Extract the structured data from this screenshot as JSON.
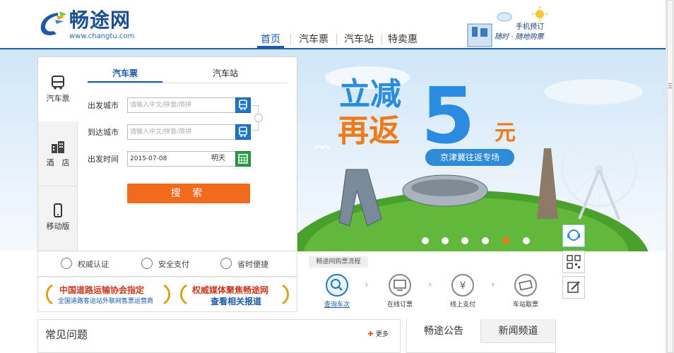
{
  "header": {
    "logo_text": "畅途网",
    "logo_url": "www.changtu.com",
    "nav": [
      {
        "label": "首页",
        "active": true
      },
      {
        "label": "汽车票",
        "active": false
      },
      {
        "label": "汽车站",
        "active": false
      },
      {
        "label": "特卖惠",
        "active": false
      }
    ],
    "mobile_promo": {
      "line1": "手机预订",
      "line2": "随时 · 随地购票"
    }
  },
  "search_panel": {
    "side_tabs": [
      {
        "label": "汽车票",
        "icon": "bus-icon",
        "active": true
      },
      {
        "label": "酒　店",
        "icon": "building-icon",
        "active": false
      },
      {
        "label": "移动版",
        "icon": "phone-icon",
        "active": false
      }
    ],
    "top_tabs": [
      {
        "label": "汽车票",
        "active": true
      },
      {
        "label": "汽车站",
        "active": false
      }
    ],
    "fields": {
      "from_label": "出发城市",
      "from_placeholder": "请输入中文/拼音/简拼",
      "to_label": "到达城市",
      "to_placeholder": "请输入中文/拼音/简拼",
      "date_label": "出发时间",
      "date_value": "2015-07-08",
      "date_hint": "明天"
    },
    "search_button": "搜 索"
  },
  "trust": [
    {
      "label": "权威认证",
      "icon": "shield-icon"
    },
    {
      "label": "安全支付",
      "icon": "secure-pay-icon"
    },
    {
      "label": "省时便捷",
      "icon": "refresh-icon"
    }
  ],
  "awards": {
    "left_title": "中国道路运输协会指定",
    "left_sub": "全国道路客运站外联网售票运营商",
    "right_title": "权威媒体聚焦畅途网",
    "right_sub": "查看相关报道"
  },
  "banner": {
    "headline1": "立减",
    "headline2": "再返",
    "amount": "5",
    "unit": "元",
    "sub": "京津冀往返专场",
    "dots": 6,
    "active_dot": 5
  },
  "process": {
    "label": "畅途网购票流程",
    "steps": [
      {
        "label": "查询车次",
        "icon": "search-icon",
        "active": true
      },
      {
        "label": "在线订票",
        "icon": "monitor-icon",
        "active": false
      },
      {
        "label": "线上支付",
        "icon": "yen-icon",
        "active": false
      },
      {
        "label": "车站取票",
        "icon": "ticket-icon",
        "active": false
      }
    ]
  },
  "floats": [
    {
      "icon": "customer-service-icon"
    },
    {
      "icon": "qr-code-icon"
    },
    {
      "icon": "edit-icon"
    }
  ],
  "faq": {
    "title": "常见问题",
    "more": "更多"
  },
  "news": {
    "tabs": [
      {
        "label": "畅途公告",
        "active": true
      },
      {
        "label": "新闻频道",
        "active": false
      }
    ]
  },
  "colors": {
    "brand_blue": "#1b5aa8",
    "accent_orange": "#f26b1d",
    "green": "#2a9c47"
  }
}
